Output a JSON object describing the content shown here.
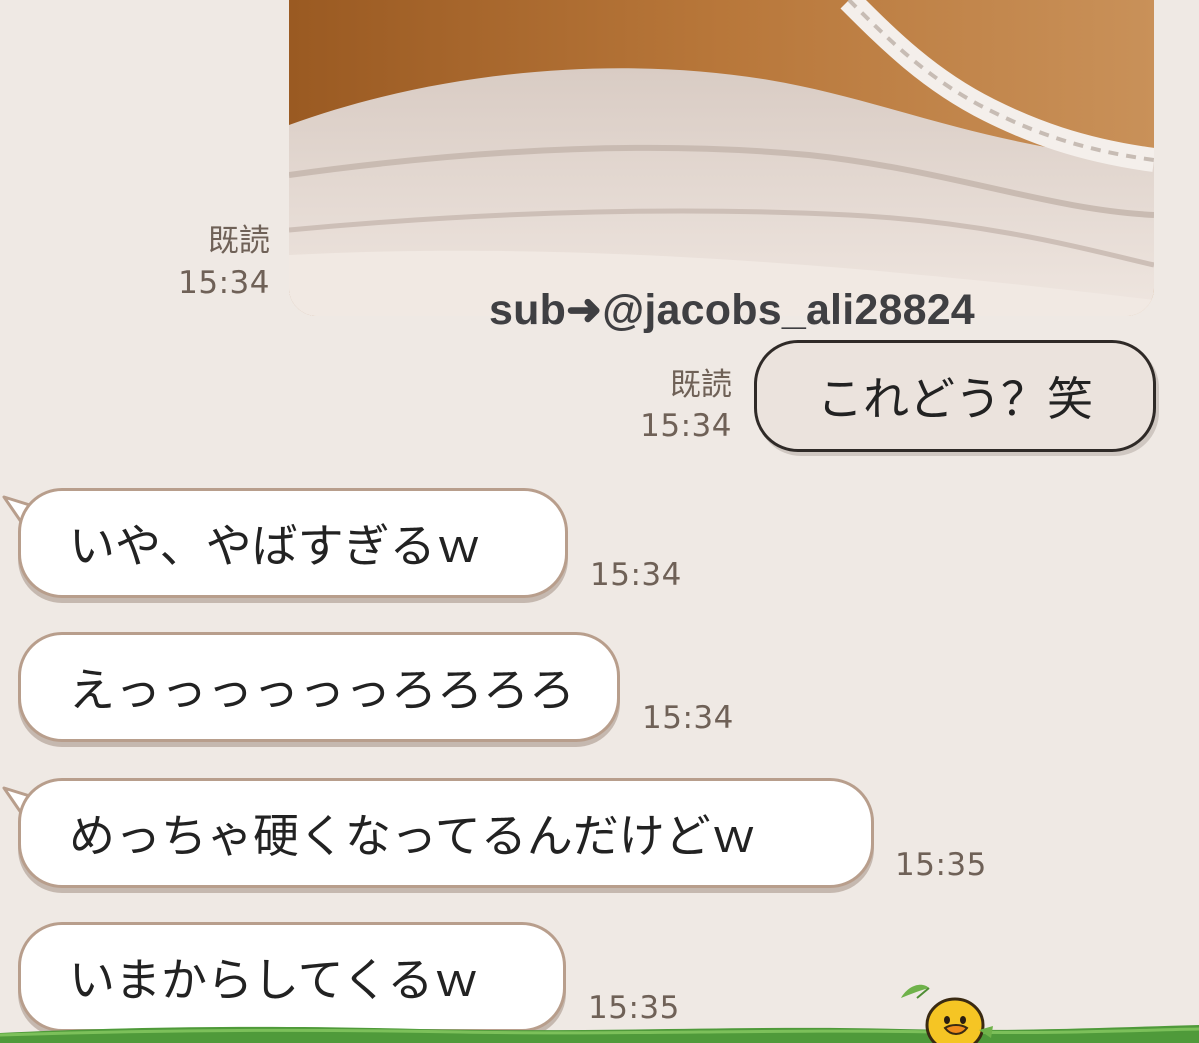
{
  "photo_message": {
    "read_label": "既読",
    "time": "15:34",
    "watermark": "sub➜@jacobs_ali28824"
  },
  "sent_messages": [
    {
      "text": "これどう？笑",
      "read_label": "既読",
      "time": "15:34"
    }
  ],
  "received_messages": [
    {
      "text": "いや、やばすぎるｗ",
      "time": "15:34"
    },
    {
      "text": "えっっっっっっろろろろ",
      "time": "15:34"
    },
    {
      "text": "めっちゃ硬くなってるんだけどｗ",
      "time": "15:35"
    },
    {
      "text": "いまからしてくるｗ",
      "time": "15:35"
    }
  ],
  "colors": {
    "background": "#efe9e4",
    "sent_bubble": "#ebe3dd",
    "received_bubble": "#ffffff",
    "grass": "#4f9a3a",
    "chick": "#f5c524"
  },
  "icons": [
    "sticker-chick-icon",
    "leaf-icon",
    "grass-footer-decoration"
  ]
}
